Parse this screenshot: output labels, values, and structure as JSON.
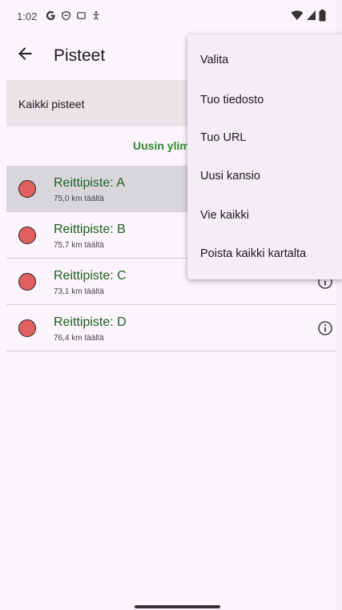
{
  "status_bar": {
    "time": "1:02",
    "left_icons": [
      "google-g-icon",
      "vpn-shield-icon",
      "square-notification-icon",
      "accessibility-icon"
    ],
    "right_icons": [
      "wifi-icon",
      "cellular-signal-icon",
      "battery-icon"
    ]
  },
  "header": {
    "title": "Pisteet",
    "back_icon": "arrow-left-icon"
  },
  "filter": {
    "label": "Kaikki pisteet"
  },
  "sort": {
    "label": "Uusin ylim"
  },
  "waypoints": [
    {
      "name": "Reittipiste: A",
      "distance": "75,0 km täältä",
      "selected": true
    },
    {
      "name": "Reittipiste: B",
      "distance": "75,7 km täältä",
      "selected": false
    },
    {
      "name": "Reittipiste: C",
      "distance": "73,1 km täältä",
      "selected": false
    },
    {
      "name": "Reittipiste: D",
      "distance": "76,4 km täältä",
      "selected": false
    }
  ],
  "overflow_menu": {
    "items": [
      {
        "label": "Valita"
      },
      {
        "label": "Tuo tiedosto"
      },
      {
        "label": "Tuo URL"
      },
      {
        "label": "Uusi kansio"
      },
      {
        "label": "Vie kaikki"
      },
      {
        "label": "Poista kaikki kartalta"
      }
    ]
  },
  "colors": {
    "background": "#fcf4fb",
    "accent_green": "#2e8a2e",
    "waypoint_dot": "#e06060",
    "selected_row": "#d9d6db"
  }
}
